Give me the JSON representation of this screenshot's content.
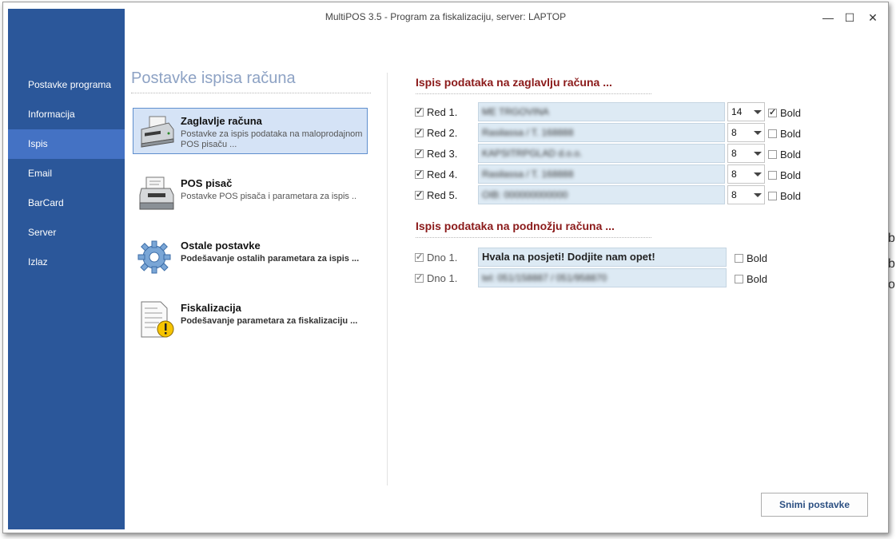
{
  "window": {
    "title": "MultiPOS 3.5 - Program za fiskalizaciju, server: LAPTOP",
    "minimize": "—",
    "maximize": "☐",
    "close": "✕"
  },
  "sidebar": {
    "items": [
      {
        "label": "Postavke programa",
        "active": false
      },
      {
        "label": "Informacija",
        "active": false
      },
      {
        "label": "Ispis",
        "active": true
      },
      {
        "label": "Email",
        "active": false
      },
      {
        "label": "BarCard",
        "active": false
      },
      {
        "label": "Server",
        "active": false
      },
      {
        "label": "Izlaz",
        "active": false
      }
    ]
  },
  "main": {
    "title": "Postavke ispisa računa",
    "cards": [
      {
        "title": "Zaglavlje računa",
        "desc": "Postavke za ispis podataka na maloprodajnom POS pisaču ...",
        "icon": "printer-icon",
        "selected": true
      },
      {
        "title": "POS pisač",
        "desc": "Postavke POS pisača i parametara za ispis ..",
        "icon": "pos-printer-icon",
        "selected": false
      },
      {
        "title": "Ostale postavke",
        "desc": "Podešavanje ostalih parametara za ispis ...",
        "icon": "gear-icon",
        "selected": false
      },
      {
        "title": "Fiskalizacija",
        "desc": "Podešavanje parametara za fiskalizaciju ...",
        "icon": "document-warning-icon",
        "selected": false
      }
    ]
  },
  "header_section": {
    "title": "Ispis podataka na zaglavlju računa ...",
    "bold_label": "Bold",
    "rows": [
      {
        "label": "Red 1.",
        "checked": true,
        "value": "ME TRGOVINA",
        "size": "14",
        "bold": true
      },
      {
        "label": "Red 2.",
        "checked": true,
        "value": "Rasilassa / T. 168888",
        "size": "8",
        "bold": false
      },
      {
        "label": "Red 3.",
        "checked": true,
        "value": "KAPSITRPGLAD d.o.o.",
        "size": "8",
        "bold": false
      },
      {
        "label": "Red 4.",
        "checked": true,
        "value": "Rasilassa / T. 168888",
        "size": "8",
        "bold": false
      },
      {
        "label": "Red 5.",
        "checked": true,
        "value": "OIB: 000000000000",
        "size": "8",
        "bold": false
      }
    ]
  },
  "footer_section": {
    "title": "Ispis podataka na podnožju računa ...",
    "bold_label": "Bold",
    "rows": [
      {
        "label": "Dno 1.",
        "checked": true,
        "value": "Hvala na posjeti! Dodjite nam opet!",
        "bold": false,
        "blurred": false
      },
      {
        "label": "Dno 1.",
        "checked": true,
        "value": "tel: 051/158887 / 051/958870",
        "bold": false,
        "blurred": true
      }
    ]
  },
  "buttons": {
    "save": "Snimi postavke"
  }
}
